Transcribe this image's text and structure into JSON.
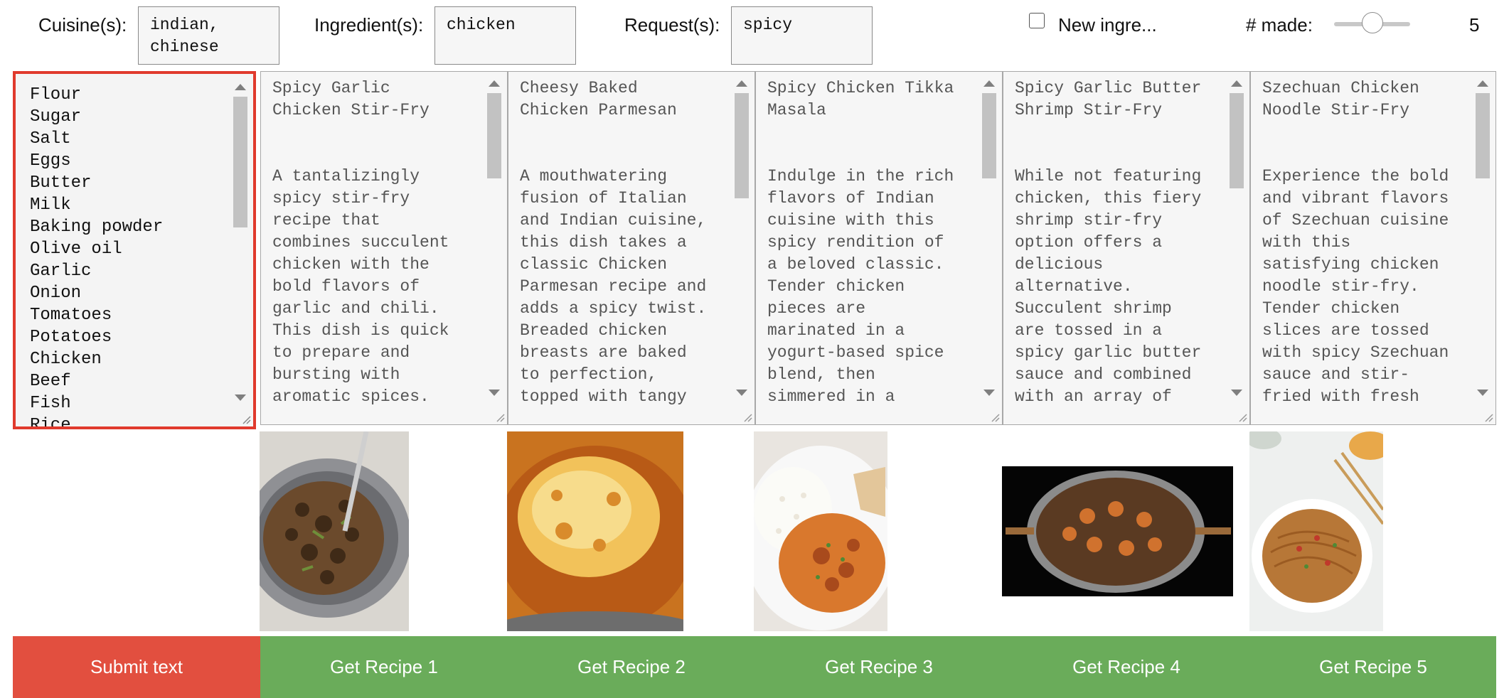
{
  "filters": {
    "cuisine_label": "Cuisine(s):",
    "cuisine_value": "indian,\nchinese",
    "ingredient_label": "Ingredient(s):",
    "ingredient_value": "chicken",
    "request_label": "Request(s):",
    "request_value": "spicy",
    "new_ingredients_label": "New ingre...",
    "new_ingredients_checked": false,
    "num_made_label": "# made:",
    "num_made_value": "5"
  },
  "ingredients": [
    "Flour",
    "Sugar",
    "Salt",
    "Eggs",
    "Butter",
    "Milk",
    "Baking powder",
    "Olive oil",
    "Garlic",
    "Onion",
    "Tomatoes",
    "Potatoes",
    "Chicken",
    "Beef",
    "Fish",
    "Rice"
  ],
  "recipes": [
    {
      "text": "Spicy Garlic\nChicken Stir-Fry\n\n\nA tantalizingly\nspicy stir-fry\nrecipe that\ncombines succulent\nchicken with the\nbold flavors of\ngarlic and chili.\nThis dish is quick\nto prepare and\nbursting with\naromatic spices.",
      "button": "Get Recipe 1",
      "image": "chicken-stir-fry-photo"
    },
    {
      "text": "Cheesy Baked\nChicken Parmesan\n\n\nA mouthwatering\nfusion of Italian\nand Indian cuisine,\nthis dish takes a\nclassic Chicken\nParmesan recipe and\nadds a spicy twist.\nBreaded chicken\nbreasts are baked\nto perfection,\ntopped with tangy",
      "button": "Get Recipe 2",
      "image": "chicken-parmesan-photo"
    },
    {
      "text": "Spicy Chicken Tikka\nMasala\n\n\nIndulge in the rich\nflavors of Indian\ncuisine with this\nspicy rendition of\na beloved classic.\nTender chicken\npieces are\nmarinated in a\nyogurt-based spice\nblend, then\nsimmered in a",
      "button": "Get Recipe 3",
      "image": "tikka-masala-photo"
    },
    {
      "text": "Spicy Garlic Butter\nShrimp Stir-Fry\n\n\nWhile not featuring\nchicken, this fiery\nshrimp stir-fry\noption offers a\ndelicious\nalternative.\nSucculent shrimp\nare tossed in a\nspicy garlic butter\nsauce and combined\nwith an array of",
      "button": "Get Recipe 4",
      "image": "shrimp-stir-fry-photo"
    },
    {
      "text": "Szechuan Chicken\nNoodle Stir-Fry\n\n\nExperience the bold\nand vibrant flavors\nof Szechuan cuisine\nwith this\nsatisfying chicken\nnoodle stir-fry.\nTender chicken\nslices are tossed\nwith spicy Szechuan\nsauce and stir-\nfried with fresh",
      "button": "Get Recipe 5",
      "image": "szechuan-noodles-photo"
    }
  ],
  "submit_label": "Submit text",
  "colors": {
    "submit": "#e24f3f",
    "recipe_button": "#6aac5a",
    "selected_border": "#e03a2d"
  }
}
